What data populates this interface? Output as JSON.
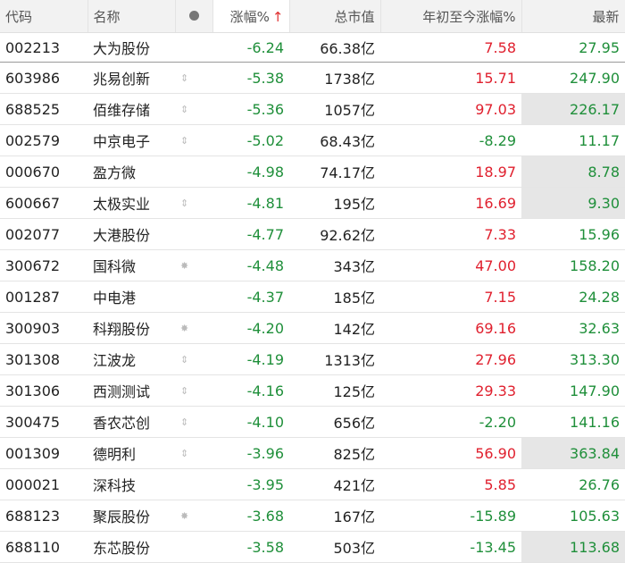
{
  "header": {
    "code": "代码",
    "name": "名称",
    "change_pct": "涨幅%",
    "sort_arrow": "↑",
    "market_cap": "总市值",
    "ytd_change": "年初至今涨幅%",
    "latest": "最新"
  },
  "colors": {
    "down": "#1f8f3a",
    "up": "#e0202e",
    "highlight": "#e6e6e6"
  },
  "rows": [
    {
      "code": "002213",
      "name": "大为股份",
      "flag": "",
      "change": "-6.24",
      "cap": "66.38亿",
      "ytd": "7.58",
      "ytd_dir": "up",
      "last": "27.95",
      "hl": false
    },
    {
      "code": "603986",
      "name": "兆易创新",
      "flag": "⇕",
      "change": "-5.38",
      "cap": "1738亿",
      "ytd": "15.71",
      "ytd_dir": "up",
      "last": "247.90",
      "hl": false
    },
    {
      "code": "688525",
      "name": "佰维存储",
      "flag": "⇕",
      "change": "-5.36",
      "cap": "1057亿",
      "ytd": "97.03",
      "ytd_dir": "up",
      "last": "226.17",
      "hl": true
    },
    {
      "code": "002579",
      "name": "中京电子",
      "flag": "⇕",
      "change": "-5.02",
      "cap": "68.43亿",
      "ytd": "-8.29",
      "ytd_dir": "down",
      "last": "11.17",
      "hl": false
    },
    {
      "code": "000670",
      "name": "盈方微",
      "flag": "",
      "change": "-4.98",
      "cap": "74.17亿",
      "ytd": "18.97",
      "ytd_dir": "up",
      "last": "8.78",
      "hl": true
    },
    {
      "code": "600667",
      "name": "太极实业",
      "flag": "⇕",
      "change": "-4.81",
      "cap": "195亿",
      "ytd": "16.69",
      "ytd_dir": "up",
      "last": "9.30",
      "hl": true
    },
    {
      "code": "002077",
      "name": "大港股份",
      "flag": "",
      "change": "-4.77",
      "cap": "92.62亿",
      "ytd": "7.33",
      "ytd_dir": "up",
      "last": "15.96",
      "hl": false
    },
    {
      "code": "300672",
      "name": "国科微",
      "flag": "✸",
      "change": "-4.48",
      "cap": "343亿",
      "ytd": "47.00",
      "ytd_dir": "up",
      "last": "158.20",
      "hl": false
    },
    {
      "code": "001287",
      "name": "中电港",
      "flag": "",
      "change": "-4.37",
      "cap": "185亿",
      "ytd": "7.15",
      "ytd_dir": "up",
      "last": "24.28",
      "hl": false
    },
    {
      "code": "300903",
      "name": "科翔股份",
      "flag": "✸",
      "change": "-4.20",
      "cap": "142亿",
      "ytd": "69.16",
      "ytd_dir": "up",
      "last": "32.63",
      "hl": false
    },
    {
      "code": "301308",
      "name": "江波龙",
      "flag": "⇕",
      "change": "-4.19",
      "cap": "1313亿",
      "ytd": "27.96",
      "ytd_dir": "up",
      "last": "313.30",
      "hl": false
    },
    {
      "code": "301306",
      "name": "西测测试",
      "flag": "⇕",
      "change": "-4.16",
      "cap": "125亿",
      "ytd": "29.33",
      "ytd_dir": "up",
      "last": "147.90",
      "hl": false
    },
    {
      "code": "300475",
      "name": "香农芯创",
      "flag": "⇕",
      "change": "-4.10",
      "cap": "656亿",
      "ytd": "-2.20",
      "ytd_dir": "down",
      "last": "141.16",
      "hl": false
    },
    {
      "code": "001309",
      "name": "德明利",
      "flag": "⇕",
      "change": "-3.96",
      "cap": "825亿",
      "ytd": "56.90",
      "ytd_dir": "up",
      "last": "363.84",
      "hl": true
    },
    {
      "code": "000021",
      "name": "深科技",
      "flag": "",
      "change": "-3.95",
      "cap": "421亿",
      "ytd": "5.85",
      "ytd_dir": "up",
      "last": "26.76",
      "hl": false
    },
    {
      "code": "688123",
      "name": "聚辰股份",
      "flag": "✸",
      "change": "-3.68",
      "cap": "167亿",
      "ytd": "-15.89",
      "ytd_dir": "down",
      "last": "105.63",
      "hl": false
    },
    {
      "code": "688110",
      "name": "东芯股份",
      "flag": "",
      "change": "-3.58",
      "cap": "503亿",
      "ytd": "-13.45",
      "ytd_dir": "down",
      "last": "113.68",
      "hl": true
    }
  ]
}
